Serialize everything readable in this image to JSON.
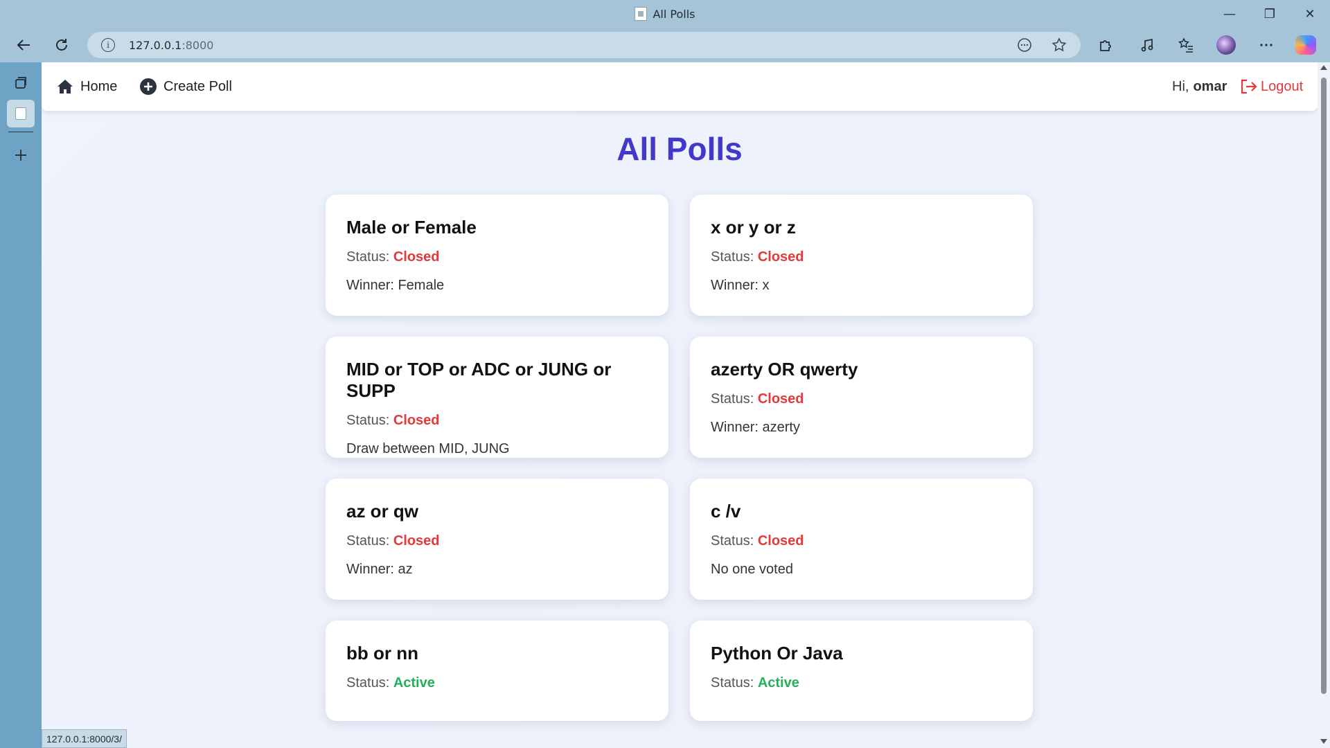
{
  "window": {
    "title": "All Polls",
    "controls": {
      "minimize": "—",
      "restore": "❐",
      "close": "✕"
    }
  },
  "browser": {
    "url_host": "127.0.0.1",
    "url_port": ":8000",
    "status_url": "127.0.0.1:8000/3/"
  },
  "nav": {
    "home_label": "Home",
    "create_label": "Create Poll",
    "greeting": "Hi,",
    "username": "omar",
    "logout_label": "Logout"
  },
  "page": {
    "title": "All Polls"
  },
  "polls": [
    {
      "title": "Male or Female",
      "status_prefix": "Status:",
      "status": "Closed",
      "result": "Winner: Female"
    },
    {
      "title": "x or y or z",
      "status_prefix": "Status:",
      "status": "Closed",
      "result": "Winner: x"
    },
    {
      "title": "MID or TOP or ADC or JUNG or SUPP",
      "status_prefix": "Status:",
      "status": "Closed",
      "result": "Draw between MID, JUNG"
    },
    {
      "title": "azerty OR qwerty",
      "status_prefix": "Status:",
      "status": "Closed",
      "result": "Winner: azerty"
    },
    {
      "title": "az or qw",
      "status_prefix": "Status:",
      "status": "Closed",
      "result": "Winner: az"
    },
    {
      "title": "c /v",
      "status_prefix": "Status:",
      "status": "Closed",
      "result": "No one voted"
    },
    {
      "title": "bb or nn",
      "status_prefix": "Status:",
      "status": "Active",
      "result": ""
    },
    {
      "title": "Python Or Java",
      "status_prefix": "Status:",
      "status": "Active",
      "result": ""
    }
  ],
  "colors": {
    "accent": "#4338ca",
    "closed": "#e5383b",
    "active": "#22b05a",
    "logout": "#e5383b"
  }
}
